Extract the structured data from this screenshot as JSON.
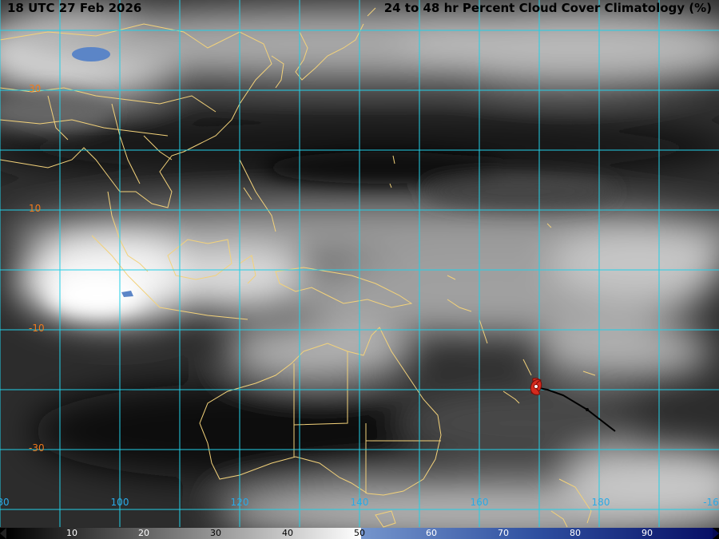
{
  "header": {
    "valid_time": "18 UTC 27 Feb 2026",
    "product_title": "24 to 48 hr Percent Cloud Cover Climatology (%)"
  },
  "grid": {
    "lat_labels": [
      "30",
      "10",
      "-10",
      "-30"
    ],
    "lon_labels": [
      "80",
      "100",
      "120",
      "140",
      "160",
      "180",
      "-16"
    ]
  },
  "colorbar": {
    "ticks": [
      "10",
      "20",
      "30",
      "40",
      "50",
      "60",
      "70",
      "80",
      "90"
    ],
    "gray_low": "#000000",
    "gray_high": "#ffffff",
    "blue_low": "#6e8fc7",
    "blue_high": "#0b1a6e"
  },
  "colors": {
    "gridline": "#22d0e8",
    "coastline": "#f3d27a",
    "lat_label": "#f07a1c",
    "lon_label": "#2aa9e6",
    "storm_track": "#000000",
    "storm_symbol": "#d32b1e",
    "high_cloud_patch": "#5b85c7"
  },
  "storm": {
    "symbol": "tropical-cyclone-icon",
    "track": "forecast-track-line"
  }
}
